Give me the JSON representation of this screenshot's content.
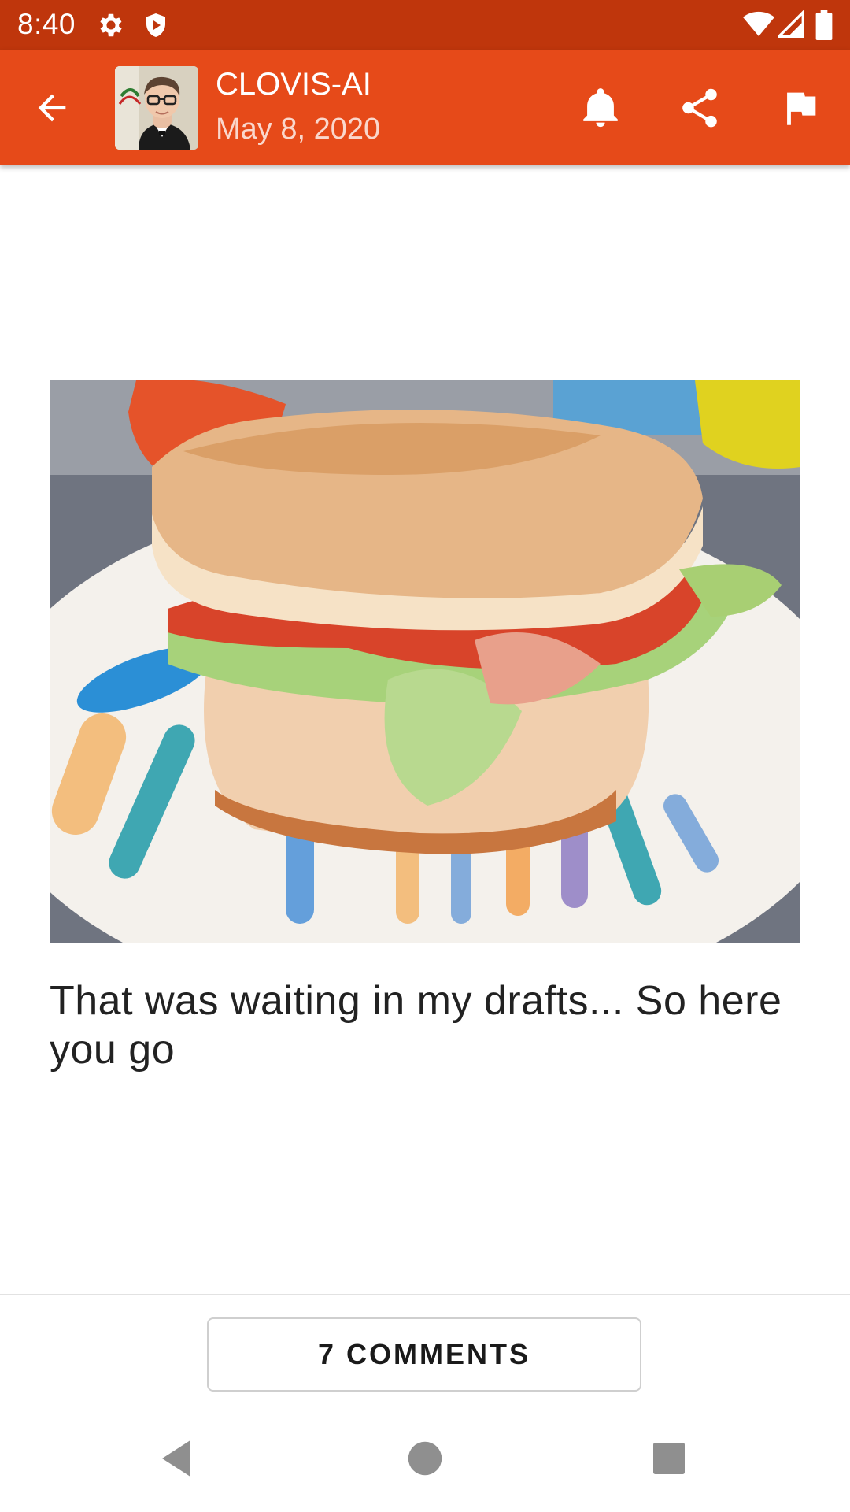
{
  "status_bar": {
    "time": "8:40",
    "icons": [
      "gear-icon",
      "shield-icon",
      "wifi-icon",
      "signal-icon",
      "battery-icon"
    ]
  },
  "app_bar": {
    "author": "CLOVIS-AI",
    "date": "May 8, 2020",
    "icons": [
      "back-arrow-icon",
      "bell-icon",
      "share-icon",
      "flag-icon"
    ],
    "background": "#e64a19"
  },
  "post": {
    "image_alt": "Toasted sandwich with tomato, lettuce and ham on a plate",
    "text": "That was waiting in my drafts... So here you go"
  },
  "footer": {
    "comments_label": "7 COMMENTS"
  },
  "nav": {
    "icons": [
      "back-triangle-icon",
      "home-circle-icon",
      "recents-square-icon"
    ]
  },
  "colors": {
    "status_bar": "#bf360c",
    "app_bar": "#e64a19"
  }
}
